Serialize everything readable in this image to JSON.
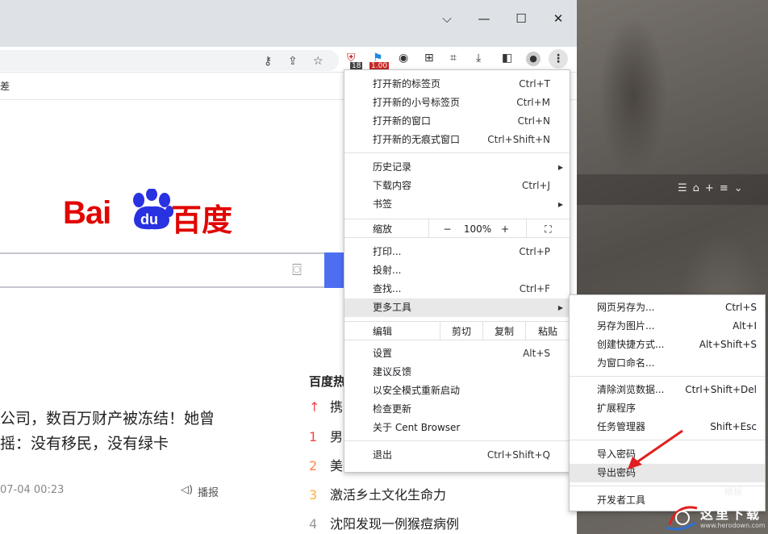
{
  "window": {
    "ctrl_dropdown": "⌵",
    "ctrl_minimize": "—",
    "ctrl_maximize": "☐",
    "ctrl_close": "✕"
  },
  "toolbar": {
    "ext_badge_1": "18",
    "ext_badge_2": "1.00"
  },
  "bookmarks": {
    "partial": "差"
  },
  "baidu": {
    "logo_bai": "Bai",
    "logo_du": "du",
    "logo_cn": "百度"
  },
  "news": {
    "line1": "公司，数百万财产被冻结！她曾",
    "line2": "摇：没有移民，没有绿卡",
    "date": "07-04 00:23",
    "play": "播报"
  },
  "hot": {
    "title": "百度热",
    "items": [
      {
        "num": "↑",
        "text": "携"
      },
      {
        "num": "1",
        "text": "男"
      },
      {
        "num": "2",
        "text": "美"
      },
      {
        "num": "3",
        "text": "激活乡土文化生命力"
      },
      {
        "num": "4",
        "text": "沈阳发现一例猴痘病例"
      }
    ]
  },
  "menu": {
    "new_tab": {
      "label": "打开新的标签页",
      "shortcut": "Ctrl+T"
    },
    "new_small_tab": {
      "label": "打开新的小号标签页",
      "shortcut": "Ctrl+M"
    },
    "new_window": {
      "label": "打开新的窗口",
      "shortcut": "Ctrl+N"
    },
    "incognito": {
      "label": "打开新的无痕式窗口",
      "shortcut": "Ctrl+Shift+N"
    },
    "history": {
      "label": "历史记录"
    },
    "downloads": {
      "label": "下载内容",
      "shortcut": "Ctrl+J"
    },
    "bookmarks": {
      "label": "书签"
    },
    "zoom": {
      "label": "缩放",
      "minus": "−",
      "value": "100%",
      "plus": "+"
    },
    "print": {
      "label": "打印...",
      "shortcut": "Ctrl+P"
    },
    "cast": {
      "label": "投射..."
    },
    "find": {
      "label": "查找...",
      "shortcut": "Ctrl+F"
    },
    "more_tools": {
      "label": "更多工具"
    },
    "edit": {
      "label": "编辑",
      "cut": "剪切",
      "copy": "复制",
      "paste": "粘贴"
    },
    "settings": {
      "label": "设置",
      "shortcut": "Alt+S"
    },
    "feedback": {
      "label": "建议反馈"
    },
    "safe_restart": {
      "label": "以安全模式重新启动"
    },
    "check_update": {
      "label": "检查更新"
    },
    "about": {
      "label": "关于 Cent Browser"
    },
    "exit": {
      "label": "退出",
      "shortcut": "Ctrl+Shift+Q"
    }
  },
  "submenu": {
    "save_page": {
      "label": "网页另存为...",
      "shortcut": "Ctrl+S"
    },
    "save_image": {
      "label": "另存为图片...",
      "shortcut": "Alt+I"
    },
    "create_shortcut": {
      "label": "创建快捷方式...",
      "shortcut": "Alt+Shift+S"
    },
    "name_window": {
      "label": "为窗口命名..."
    },
    "clear_data": {
      "label": "清除浏览数据...",
      "shortcut": "Ctrl+Shift+Del"
    },
    "extensions": {
      "label": "扩展程序"
    },
    "task_manager": {
      "label": "任务管理器",
      "shortcut": "Shift+Esc"
    },
    "import_pw": {
      "label": "导入密码"
    },
    "export_pw": {
      "label": "导出密码"
    },
    "devtools": {
      "label": "开发者工具"
    }
  },
  "wallpaper": {
    "label": "播报",
    "watermark_text": "这里下载",
    "watermark_url": "www.herodown.com"
  }
}
